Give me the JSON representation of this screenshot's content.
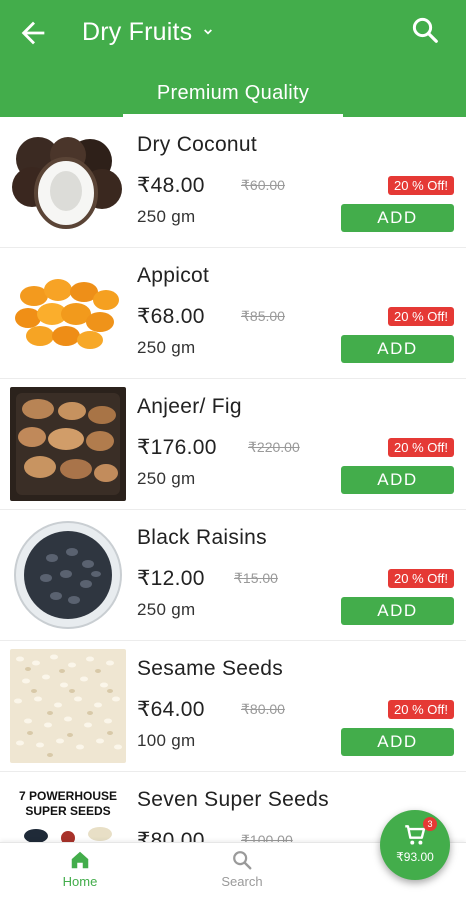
{
  "header": {
    "title": "Dry Fruits",
    "tab": "Premium Quality",
    "back_icon": "arrow-left-icon",
    "search_icon": "search-icon",
    "dropdown_icon": "chevron-down-icon"
  },
  "products": [
    {
      "name": "Dry Coconut",
      "price": "₹48.00",
      "mrp": "₹60.00",
      "weight": "250 gm",
      "discount": "20 % Off!",
      "add_label": "ADD"
    },
    {
      "name": "Appicot",
      "price": "₹68.00",
      "mrp": "₹85.00",
      "weight": "250 gm",
      "discount": "20 % Off!",
      "add_label": "ADD"
    },
    {
      "name": "Anjeer/ Fig",
      "price": "₹176.00",
      "mrp": "₹220.00",
      "weight": "250 gm",
      "discount": "20 % Off!",
      "add_label": "ADD"
    },
    {
      "name": "Black Raisins",
      "price": "₹12.00",
      "mrp": "₹15.00",
      "weight": "250 gm",
      "discount": "20 % Off!",
      "add_label": "ADD"
    },
    {
      "name": "Sesame Seeds",
      "price": "₹64.00",
      "mrp": "₹80.00",
      "weight": "100 gm",
      "discount": "20 % Off!",
      "add_label": "ADD"
    },
    {
      "name": "Seven Super Seeds",
      "price": "₹80.00",
      "mrp": "₹100.00",
      "weight": "",
      "discount": "",
      "add_label": "",
      "image_text": "7 POWERHOUSE SUPER SEEDS"
    }
  ],
  "bottom_nav": {
    "home_label": "Home",
    "search_label": "Search"
  },
  "cart": {
    "count": "3",
    "total": "₹93.00"
  },
  "colors": {
    "primary": "#43ad4b",
    "discount": "#e53935"
  }
}
